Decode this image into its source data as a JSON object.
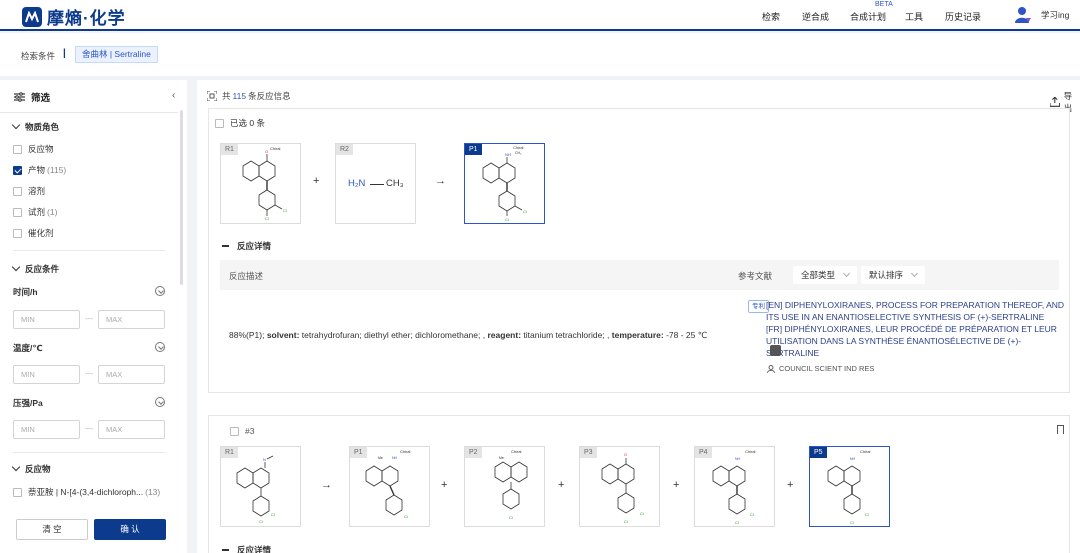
{
  "app": {
    "logo_text": "摩熵·化学",
    "nav": [
      "检索",
      "逆合成",
      "合成计划",
      "工具",
      "历史记录"
    ],
    "beta": "BETA",
    "username": "学习ing",
    "brand_color": "#0c3a8c"
  },
  "crumb": {
    "label": "检索条件",
    "separator": "|",
    "tag": "舍曲林 | Sertraline"
  },
  "sidebar": {
    "title": "筛选",
    "collapse_icon": "chevron-left-icon",
    "role_section": "物质角色",
    "roles": [
      {
        "label": "反应物",
        "count": "",
        "checked": false
      },
      {
        "label": "产物",
        "count": "(115)",
        "checked": true
      },
      {
        "label": "溶剂",
        "count": "",
        "checked": false
      },
      {
        "label": "试剂",
        "count": "(1)",
        "checked": false
      },
      {
        "label": "催化剂",
        "count": "",
        "checked": false
      }
    ],
    "cond_section": "反应条件",
    "conditions": [
      {
        "label": "时间/h",
        "min": "MIN",
        "max": "MAX"
      },
      {
        "label": "温度/℃",
        "min": "MIN",
        "max": "MAX"
      },
      {
        "label": "压强/Pa",
        "min": "MIN",
        "max": "MAX"
      }
    ],
    "dash": "—",
    "reactant_section": "反应物",
    "reactants": [
      {
        "label": "萘亚胺 | N-[4-(3,4-dichloroph...",
        "count": "(13)",
        "checked": false
      }
    ],
    "clear_label": "清 空",
    "confirm_label": "确 认"
  },
  "main": {
    "count_prefix": "共",
    "count": "115",
    "count_suffix": "条反应信息",
    "export_label": "导出",
    "card1": {
      "select_all": "已选 0 条",
      "molecules": [
        {
          "tag": "R1",
          "label": "Chiral"
        },
        {
          "tag": "R2",
          "formula_left": "H₂N",
          "formula_right": "CH₃"
        },
        {
          "tag": "P1",
          "label": "Chiral",
          "label2": "CH₃"
        }
      ],
      "plus": "+",
      "arrow": "→",
      "detail_title": "反应详情",
      "table_head_desc": "反应描述",
      "table_head_ref": "参考文献",
      "filter_type": "全部类型",
      "filter_sort": "默认排序",
      "desc_yield": "88%(P1);",
      "desc_solvent_k": "solvent:",
      "desc_solvent_v": " tetrahydrofuran; diethyl ether; dichloromethane; ,",
      "desc_reagent_k": "reagent:",
      "desc_reagent_v": " titanium tetrachloride; ,",
      "desc_temp_k": "temperature:",
      "desc_temp_v": " -78 - 25 ℃",
      "patent_tag": "专利",
      "ref_en": "[EN] DIPHENYLOXIRANES, PROCESS FOR PREPARATION THEREOF, AND ITS USE IN AN ENANTIOSELECTIVE SYNTHESIS OF (+)-SERTRALINE",
      "ref_fr": "[FR] DIPHÉNYLOXIRANES, LEUR PROCÉDÉ DE PRÉPARATION ET LEUR UTILISATION DANS LA SYNTHÈSE ÉNANTIOSÉLECTIVE DE (+)-SERTRALINE",
      "org": "COUNCIL SCIENT IND RES"
    },
    "card2": {
      "number": "#3",
      "molecules": [
        {
          "tag": "R1"
        },
        {
          "tag": "P1",
          "label": "Chiral"
        },
        {
          "tag": "P2",
          "label": "Chiral"
        },
        {
          "tag": "P3"
        },
        {
          "tag": "P4",
          "label": "Chiral"
        },
        {
          "tag": "P5",
          "label": "Chiral"
        }
      ],
      "detail_title": "反应详情"
    }
  }
}
